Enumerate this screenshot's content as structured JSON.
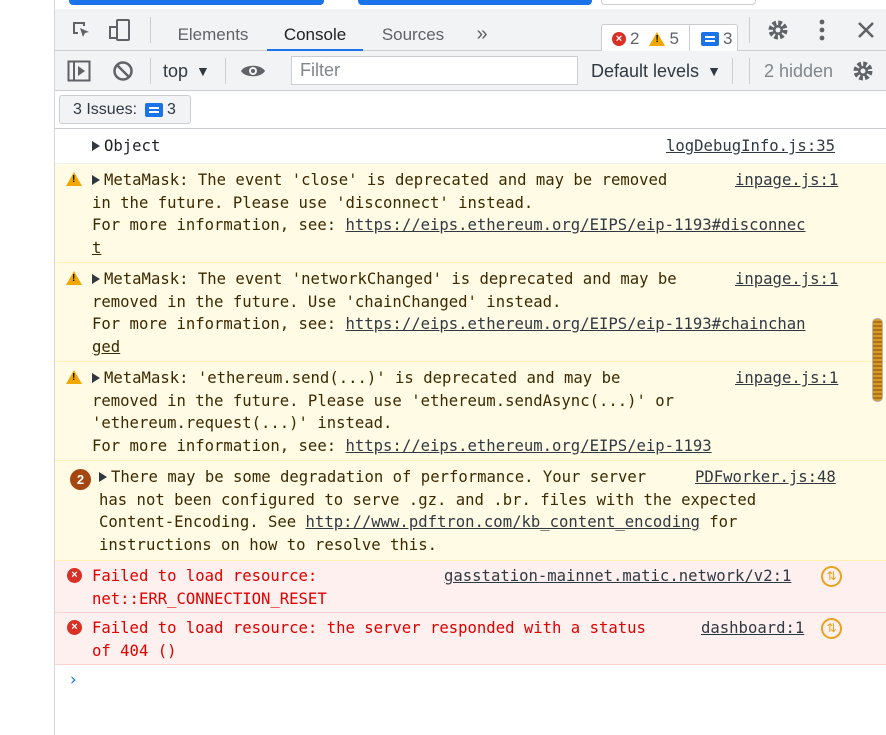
{
  "tabs": {
    "elements": "Elements",
    "console": "Console",
    "sources": "Sources",
    "more": "»"
  },
  "counters": {
    "errors": "2",
    "warnings": "5",
    "messages": "3"
  },
  "console_toolbar": {
    "context": "top",
    "filter_placeholder": "Filter",
    "levels": "Default levels",
    "hidden": "2 hidden"
  },
  "issues": {
    "label": "3 Issues:",
    "count": "3"
  },
  "messages": [
    {
      "level": "log",
      "lines": [
        "Object"
      ],
      "source": "logDebugInfo.js:35"
    },
    {
      "level": "warning",
      "lines": [
        "MetaMask: The event 'close' is deprecated and may be removed",
        "in the future. Please use 'disconnect' instead.",
        "For more information, see: ",
        "t"
      ],
      "link": "https://eips.ethereum.org/EIPS/eip-1193#disconnec",
      "source": "inpage.js:1"
    },
    {
      "level": "warning",
      "lines": [
        "MetaMask: The event 'networkChanged' is deprecated and may be",
        "removed in the future. Use 'chainChanged' instead.",
        "For more information, see: ",
        "ged"
      ],
      "link": "https://eips.ethereum.org/EIPS/eip-1193#chainchan",
      "source": "inpage.js:1"
    },
    {
      "level": "warning",
      "lines": [
        "MetaMask: 'ethereum.send(...)' is deprecated and may be",
        "removed in the future. Please use 'ethereum.sendAsync(...)' or",
        "'ethereum.request(...)' instead.",
        "For more information, see: "
      ],
      "link": "https://eips.ethereum.org/EIPS/eip-1193",
      "source": "inpage.js:1"
    },
    {
      "level": "warning",
      "repeat": "2",
      "lines": [
        "There may be some degradation of performance. Your server",
        "has not been configured to serve .gz. and .br. files with the expected",
        "Content-Encoding. See ",
        " for",
        "instructions on how to resolve this."
      ],
      "link": "http://www.pdftron.com/kb_content_encoding",
      "source": "PDFworker.js:48"
    },
    {
      "level": "error",
      "lines": [
        "Failed to load resource:",
        "net::ERR_CONNECTION_RESET"
      ],
      "source": "gasstation-mainnet.matic.network/v2:1"
    },
    {
      "level": "error",
      "lines": [
        "Failed to load resource: the server responded with a status",
        "of 404 ()"
      ],
      "source": "dashboard:1"
    }
  ],
  "prompt": "›"
}
